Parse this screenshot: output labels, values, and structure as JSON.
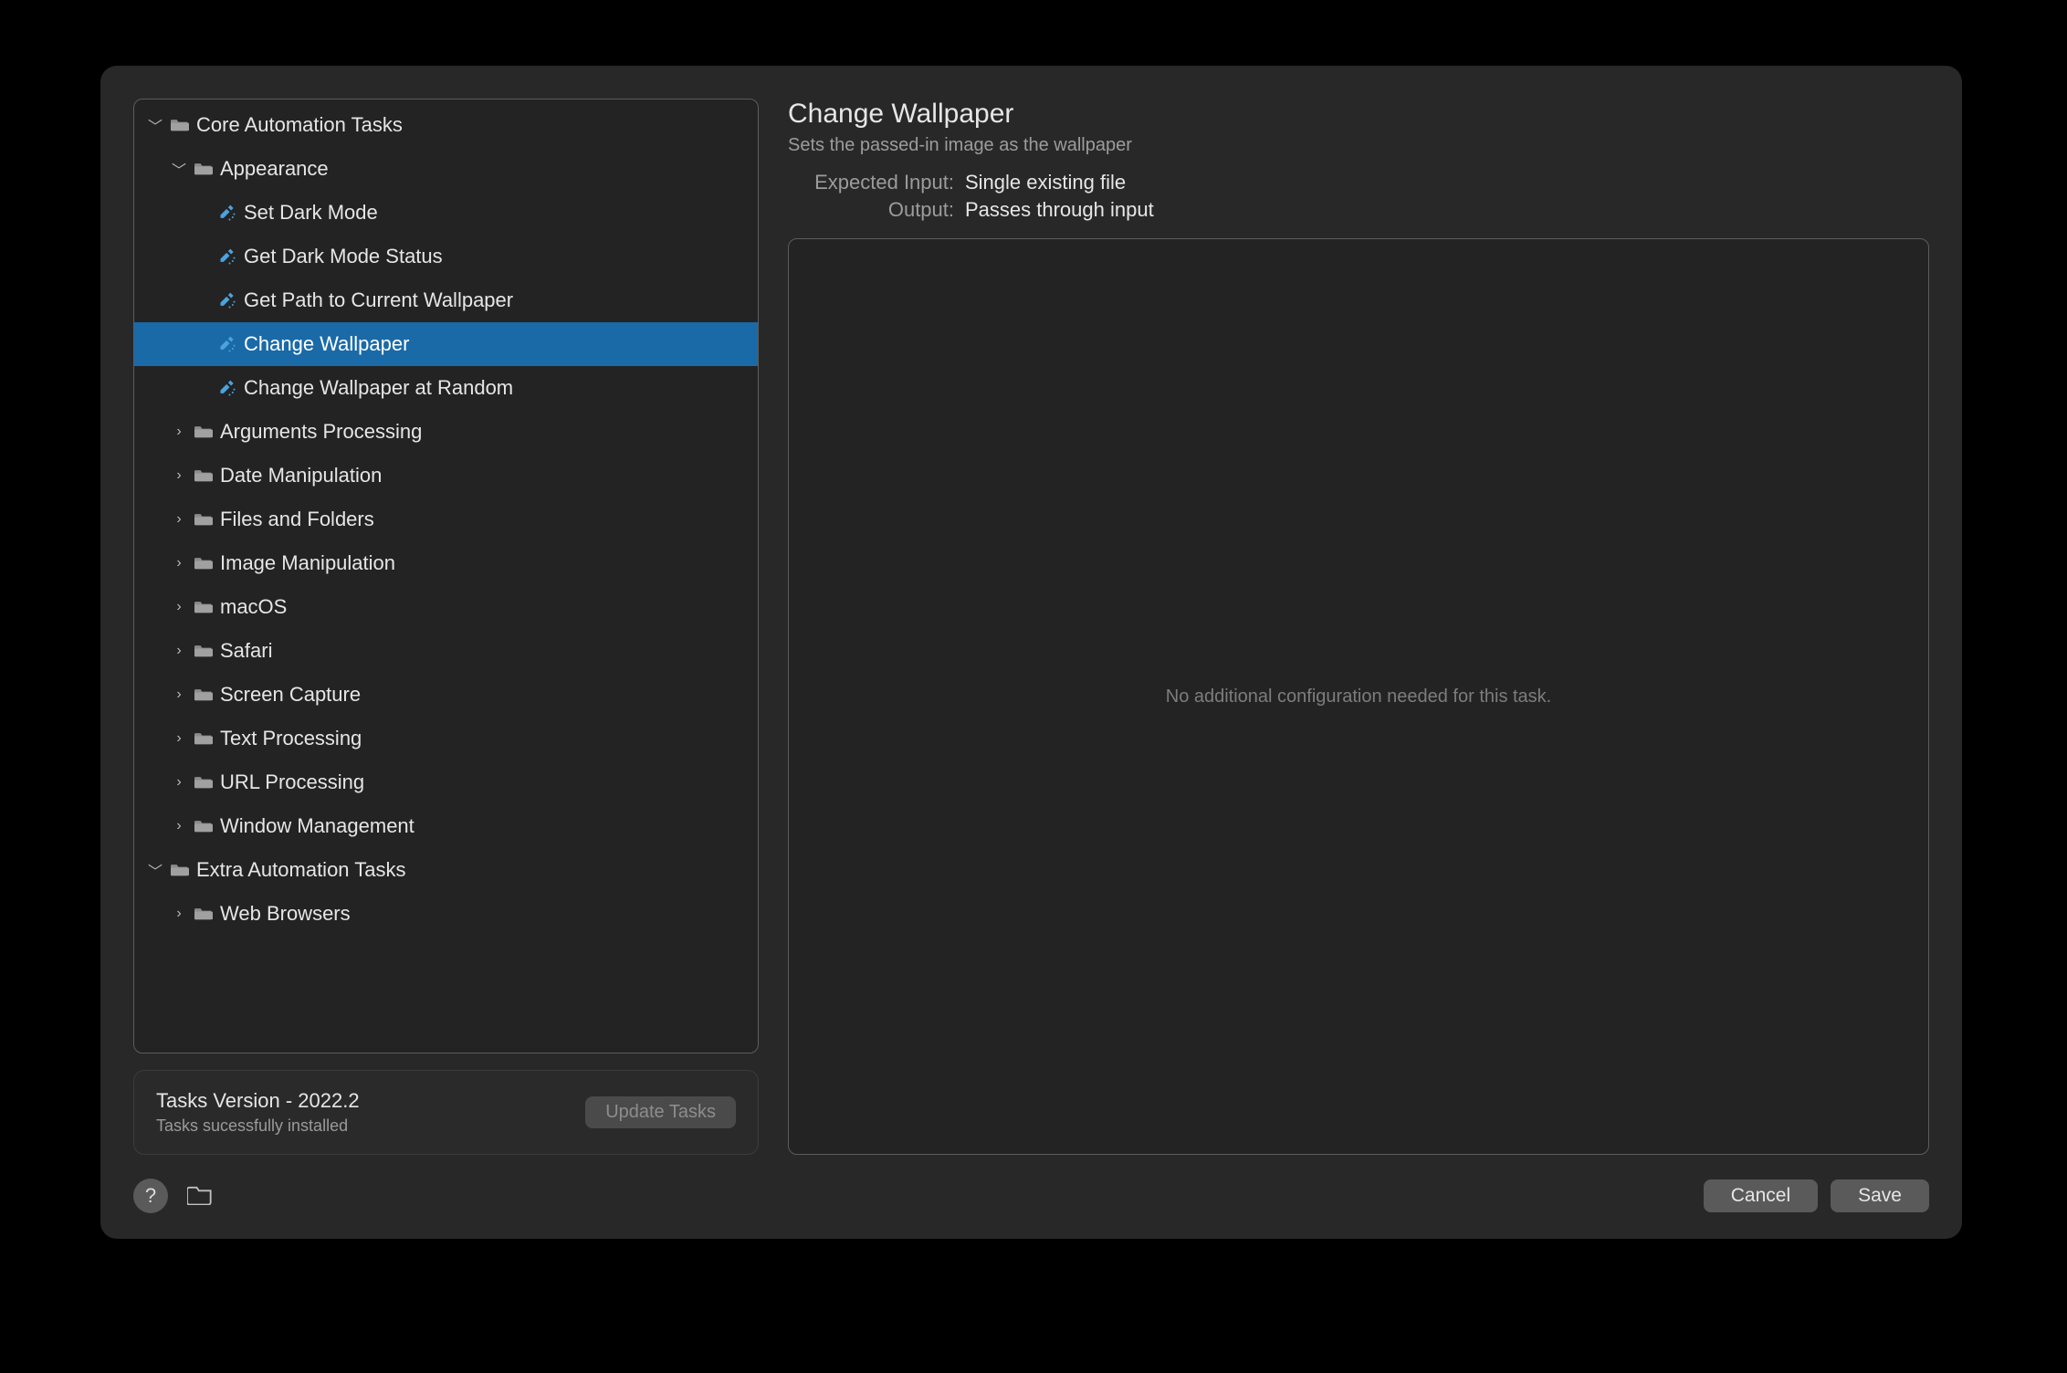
{
  "tree": [
    {
      "indent": 0,
      "expanded": true,
      "kind": "folder",
      "label": "Core Automation Tasks",
      "selected": false
    },
    {
      "indent": 1,
      "expanded": true,
      "kind": "folder",
      "label": "Appearance",
      "selected": false
    },
    {
      "indent": 2,
      "expanded": null,
      "kind": "task",
      "label": "Set Dark Mode",
      "selected": false
    },
    {
      "indent": 2,
      "expanded": null,
      "kind": "task",
      "label": "Get Dark Mode Status",
      "selected": false
    },
    {
      "indent": 2,
      "expanded": null,
      "kind": "task",
      "label": "Get Path to Current Wallpaper",
      "selected": false
    },
    {
      "indent": 2,
      "expanded": null,
      "kind": "task",
      "label": "Change Wallpaper",
      "selected": true
    },
    {
      "indent": 2,
      "expanded": null,
      "kind": "task",
      "label": "Change Wallpaper at Random",
      "selected": false
    },
    {
      "indent": 1,
      "expanded": false,
      "kind": "folder",
      "label": "Arguments Processing",
      "selected": false
    },
    {
      "indent": 1,
      "expanded": false,
      "kind": "folder",
      "label": "Date Manipulation",
      "selected": false
    },
    {
      "indent": 1,
      "expanded": false,
      "kind": "folder",
      "label": "Files and Folders",
      "selected": false
    },
    {
      "indent": 1,
      "expanded": false,
      "kind": "folder",
      "label": "Image Manipulation",
      "selected": false
    },
    {
      "indent": 1,
      "expanded": false,
      "kind": "folder",
      "label": "macOS",
      "selected": false
    },
    {
      "indent": 1,
      "expanded": false,
      "kind": "folder",
      "label": "Safari",
      "selected": false
    },
    {
      "indent": 1,
      "expanded": false,
      "kind": "folder",
      "label": "Screen Capture",
      "selected": false
    },
    {
      "indent": 1,
      "expanded": false,
      "kind": "folder",
      "label": "Text Processing",
      "selected": false
    },
    {
      "indent": 1,
      "expanded": false,
      "kind": "folder",
      "label": "URL Processing",
      "selected": false
    },
    {
      "indent": 1,
      "expanded": false,
      "kind": "folder",
      "label": "Window Management",
      "selected": false
    },
    {
      "indent": 0,
      "expanded": true,
      "kind": "folder",
      "label": "Extra Automation Tasks",
      "selected": false
    },
    {
      "indent": 1,
      "expanded": false,
      "kind": "folder",
      "label": "Web Browsers",
      "selected": false
    }
  ],
  "version": {
    "line": "Tasks Version - 2022.2",
    "sub": "Tasks sucessfully installed",
    "update": "Update Tasks",
    "update_enabled": false
  },
  "detail": {
    "title": "Change Wallpaper",
    "desc": "Sets the passed-in image as the wallpaper",
    "rows": [
      {
        "label": "Expected Input:",
        "value": "Single existing file"
      },
      {
        "label": "Output:",
        "value": "Passes through input"
      }
    ],
    "config_placeholder": "No additional configuration needed for this task."
  },
  "footer": {
    "help": "?",
    "cancel": "Cancel",
    "save": "Save"
  }
}
